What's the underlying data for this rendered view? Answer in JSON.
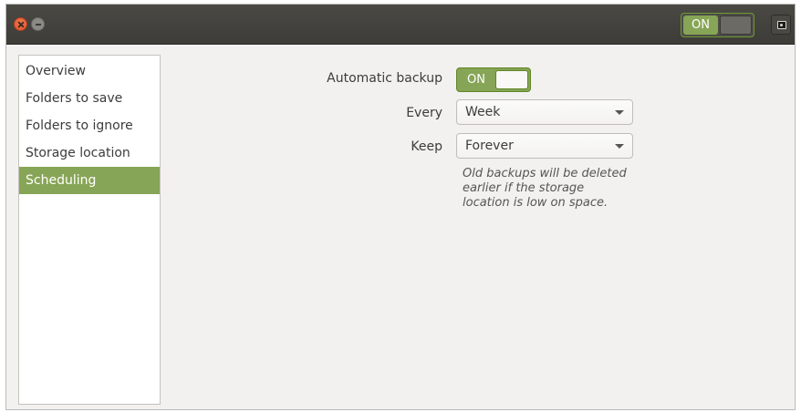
{
  "titlebar": {
    "close_icon": "close-icon",
    "minimize_icon": "minimize-icon",
    "switch_label": "ON",
    "camera_icon": "camera-icon"
  },
  "sidebar": {
    "items": [
      {
        "label": "Overview"
      },
      {
        "label": "Folders to save"
      },
      {
        "label": "Folders to ignore"
      },
      {
        "label": "Storage location"
      },
      {
        "label": "Scheduling",
        "selected": true
      }
    ]
  },
  "form": {
    "automatic_backup_label": "Automatic backup",
    "automatic_backup_state": "ON",
    "every_label": "Every",
    "every_value": "Week",
    "keep_label": "Keep",
    "keep_value": "Forever",
    "note": "Old backups will be deleted\nearlier if the storage\nlocation is low on space."
  },
  "colors": {
    "accent": "#87a556",
    "titlebar": "#42413d",
    "close": "#e9623a"
  }
}
